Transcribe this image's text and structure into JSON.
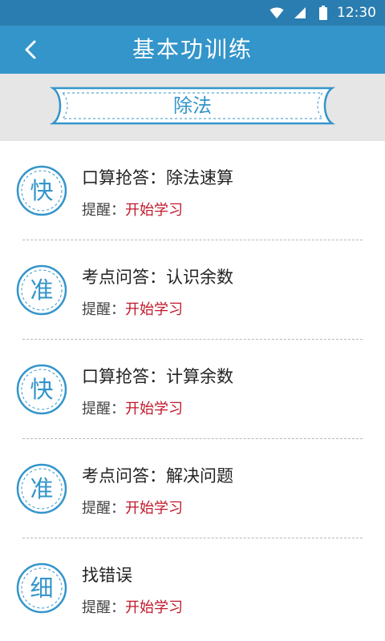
{
  "status_bar": {
    "time": "12:30"
  },
  "header": {
    "title": "基本功训练"
  },
  "section": {
    "label": "除法"
  },
  "items": [
    {
      "badge": "快",
      "title": "口算抢答：除法速算",
      "hint_label": "提醒：",
      "hint_action": "开始学习"
    },
    {
      "badge": "准",
      "title": "考点问答：认识余数",
      "hint_label": "提醒：",
      "hint_action": "开始学习"
    },
    {
      "badge": "快",
      "title": "口算抢答：计算余数",
      "hint_label": "提醒：",
      "hint_action": "开始学习"
    },
    {
      "badge": "准",
      "title": "考点问答：解决问题",
      "hint_label": "提醒：",
      "hint_action": "开始学习"
    },
    {
      "badge": "细",
      "title": "找错误",
      "hint_label": "提醒：",
      "hint_action": "开始学习"
    }
  ],
  "colors": {
    "primary": "#3395ca",
    "status_bar": "#2a7db0",
    "action": "#c0182a",
    "band": "#e6e6e6"
  },
  "icons": {
    "back": "chevron-left-icon",
    "wifi": "wifi-icon",
    "signal": "signal-icon",
    "battery": "battery-icon"
  }
}
